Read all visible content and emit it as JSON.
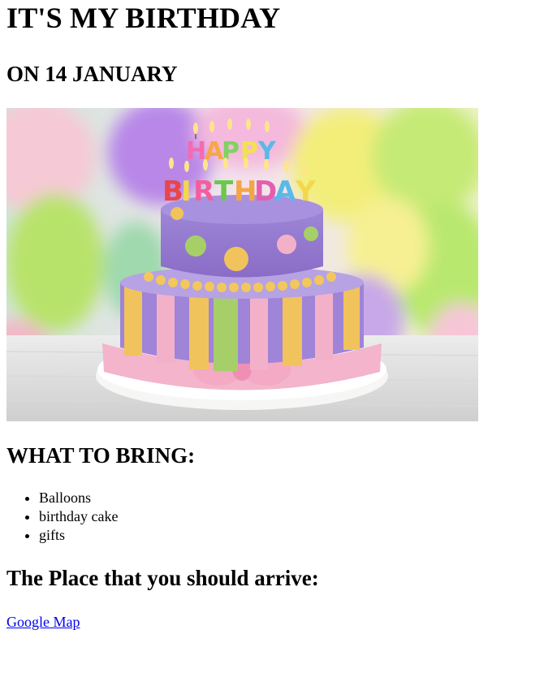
{
  "page": {
    "title": "IT'S MY BIRTHDAY",
    "date_heading": "ON 14 JANUARY",
    "bring_heading": "WHAT TO BRING:",
    "bring_items": [
      "Balloons",
      "birthday cake",
      "gifts"
    ],
    "place_heading": "The Place that you should arrive:",
    "map_link_label": "Google Map"
  },
  "image": {
    "cake_text_line1": "HAPPY",
    "cake_text_line2": "BIRTHDAY"
  },
  "colors": {
    "link": "#0000ee",
    "text": "#000000"
  }
}
